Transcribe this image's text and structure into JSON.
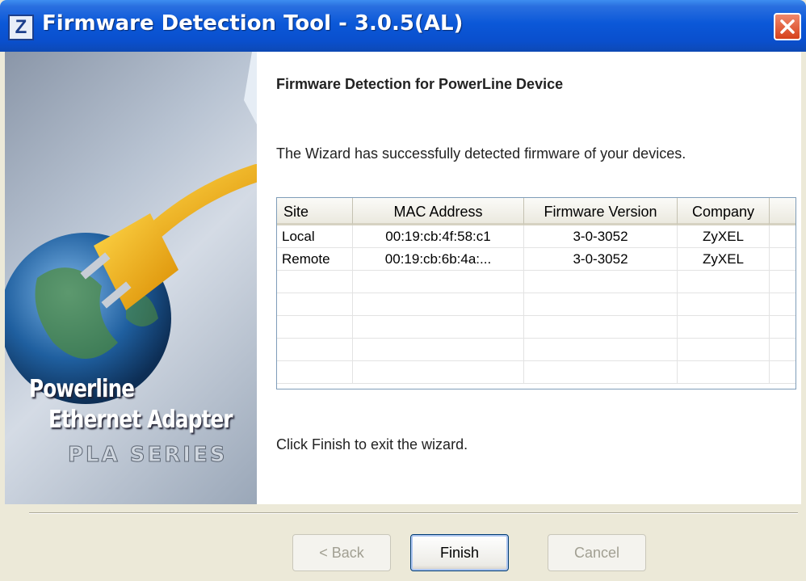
{
  "window": {
    "title": "Firmware Detection Tool - 3.0.5(AL)",
    "app_icon_letter": "Z"
  },
  "sidebar": {
    "brand_line1": "Powerline",
    "brand_line2": "Ethernet Adapter",
    "brand_line3": "PLA SERIES"
  },
  "content": {
    "heading": "Firmware Detection for PowerLine Device",
    "intro": "The Wizard has successfully detected firmware of your devices.",
    "finish_note": "Click Finish to exit the wizard."
  },
  "table": {
    "columns": [
      "Site",
      "MAC Address",
      "Firmware Version",
      "Company"
    ],
    "rows": [
      [
        "Local",
        "00:19:cb:4f:58:c1",
        "3-0-3052",
        "ZyXEL"
      ],
      [
        "Remote",
        "00:19:cb:6b:4a:...",
        "3-0-3052",
        "ZyXEL"
      ]
    ]
  },
  "buttons": {
    "back": "< Back",
    "finish": "Finish",
    "cancel": "Cancel"
  }
}
